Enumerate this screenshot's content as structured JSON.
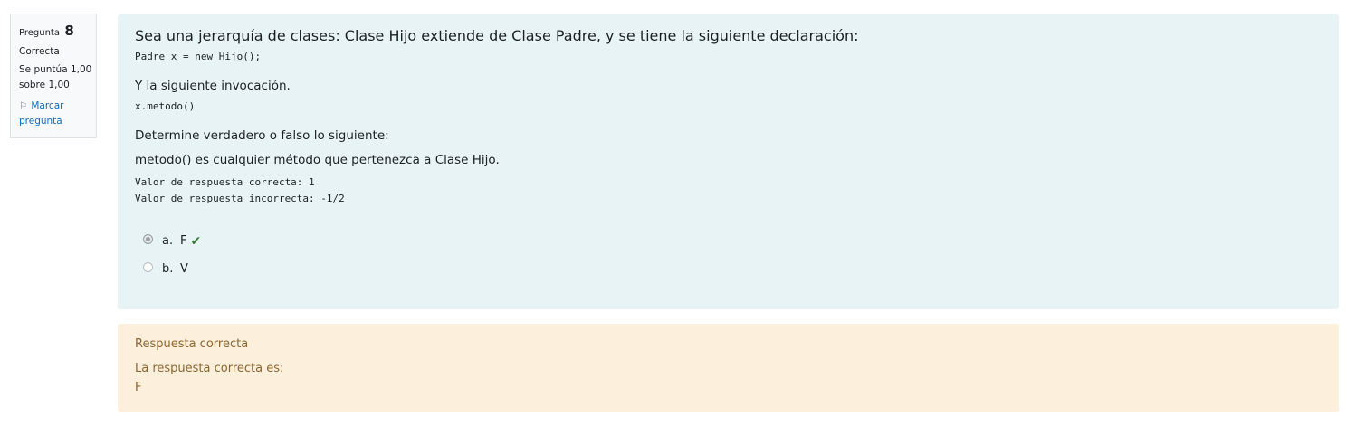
{
  "info": {
    "question_label": "Pregunta",
    "question_number": "8",
    "state": "Correcta",
    "grade_line1": "Se puntúa 1,00",
    "grade_line2": "sobre 1,00",
    "flag_line1": "Marcar",
    "flag_line2": "pregunta",
    "flag_icon": "flag-icon"
  },
  "question": {
    "title": "Sea una jerarquía de clases: Clase Hijo extiende de Clase Padre, y se tiene la siguiente declaración:",
    "code1": "Padre x = new Hijo();",
    "text2": "Y la siguiente invocación.",
    "code2": "x.metodo()",
    "text3": "Determine verdadero o falso lo siguiente:",
    "text4": "metodo() es cualquier método que pertenezca a Clase Hijo.",
    "code3_line1": "Valor de respuesta correcta: 1",
    "code3_line2": "Valor de respuesta incorrecta: -1/2",
    "options": [
      {
        "letter": "a.",
        "text": "F",
        "selected": true,
        "correct": true
      },
      {
        "letter": "b.",
        "text": "V",
        "selected": false,
        "correct": false
      }
    ]
  },
  "feedback": {
    "status": "Respuesta correcta",
    "label": "La respuesta correcta es:",
    "answer": "F"
  }
}
